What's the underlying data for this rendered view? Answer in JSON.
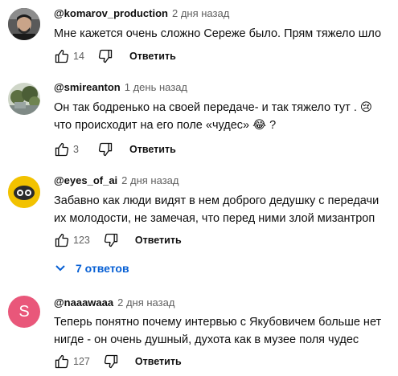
{
  "comments": [
    {
      "author": "@komarov_production",
      "time": "2 дня назад",
      "text_lines": [
        "Мне кажется очень сложно Сереже было. Прям тяжело шло"
      ],
      "likes": "14",
      "reply_label": "Ответить",
      "avatar": {
        "type": "photo",
        "color": "#4a4a4a"
      }
    },
    {
      "author": "@smireanton",
      "time": "1 день назад",
      "text_lines": [
        "Он так бодренько на своей передаче- и так тяжело тут . 😢",
        "что происходит на его поле «чудес» 😂 ?"
      ],
      "likes": "3",
      "reply_label": "Ответить",
      "avatar": {
        "type": "photo",
        "color": "#6d7a52"
      }
    },
    {
      "author": "@eyes_of_ai",
      "time": "2 дня назад",
      "text_lines": [
        "Забавно как люди видят в нем доброго дедушку с передачи",
        "их молодости, не замечая, что перед ними злой мизантроп"
      ],
      "likes": "123",
      "reply_label": "Ответить",
      "avatar": {
        "type": "icon",
        "color": "#f2c200"
      },
      "replies_label": "7 ответов"
    },
    {
      "author": "@naaawaaa",
      "time": "2 дня назад",
      "text_lines": [
        "Теперь понятно почему интервью с Якубовичем больше нет",
        "нигде  - он очень душный, духота как в музее поля чудес"
      ],
      "likes": "127",
      "reply_label": "Ответить",
      "avatar": {
        "type": "letter",
        "letter": "S",
        "color": "#e9577a"
      }
    }
  ],
  "colors": {
    "link": "#065fd4",
    "muted": "#606060",
    "text": "#0f0f0f"
  }
}
